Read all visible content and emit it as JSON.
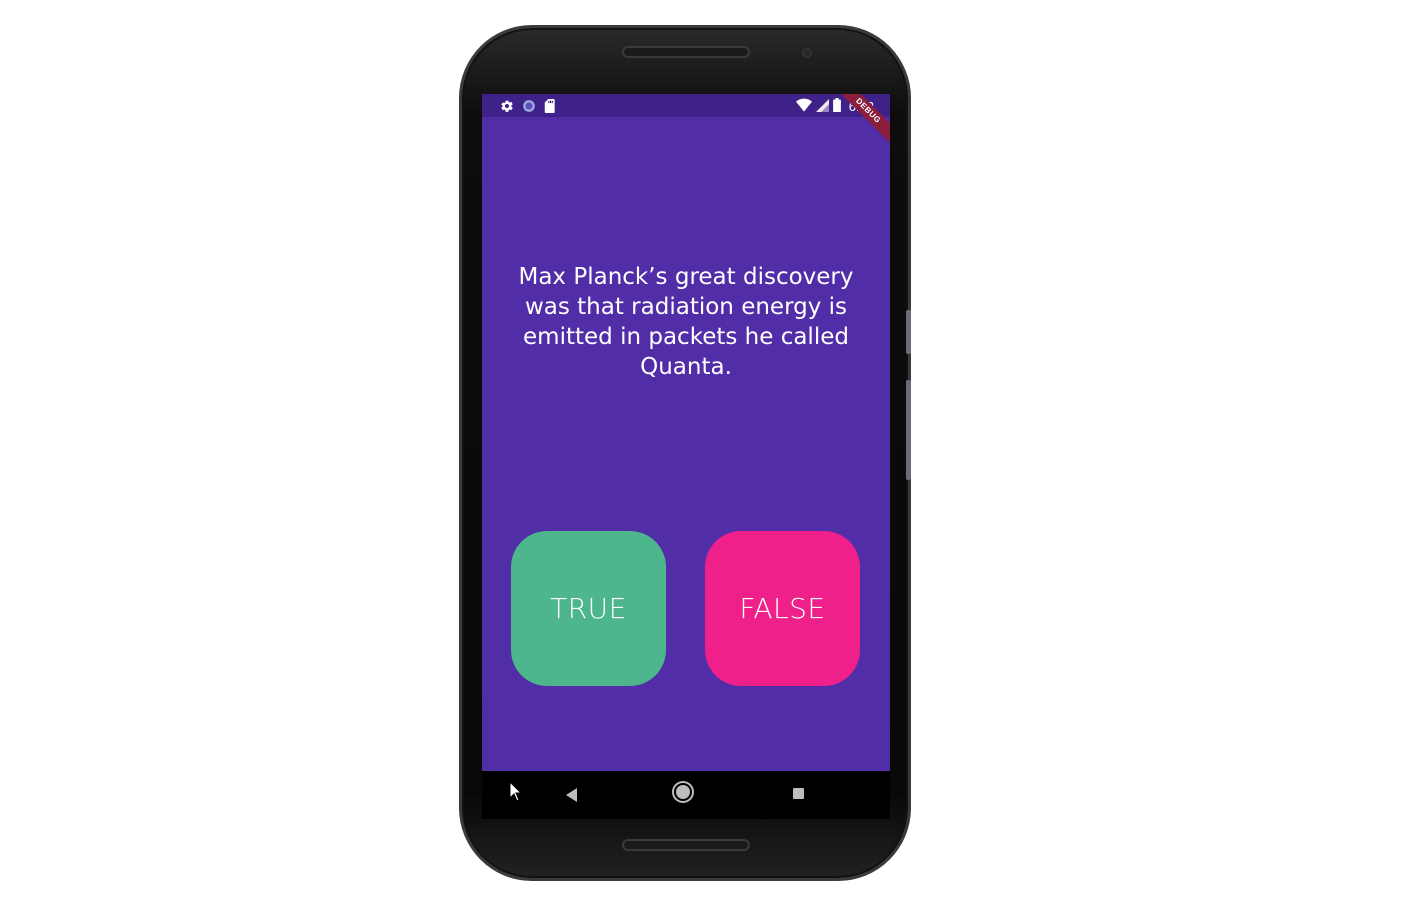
{
  "status_bar": {
    "time": "6:03",
    "left_icons": [
      "settings-icon",
      "sync-icon",
      "sd-card-icon"
    ],
    "right_icons": [
      "wifi-icon",
      "signal-icon",
      "battery-icon"
    ],
    "debug_banner": "DEBUG"
  },
  "quiz": {
    "question": "Max Planck’s great discovery was that radiation energy is emitted in packets he called Quanta.",
    "true_label": "TRUE",
    "false_label": "FALSE"
  },
  "nav_bar": {
    "icons": [
      "back-icon",
      "home-icon",
      "recent-apps-icon"
    ]
  },
  "colors": {
    "background": "#512da8",
    "status_bar": "#3f2289",
    "true_button": "#4db68c",
    "false_button": "#f0208a",
    "text": "#ffffff"
  }
}
